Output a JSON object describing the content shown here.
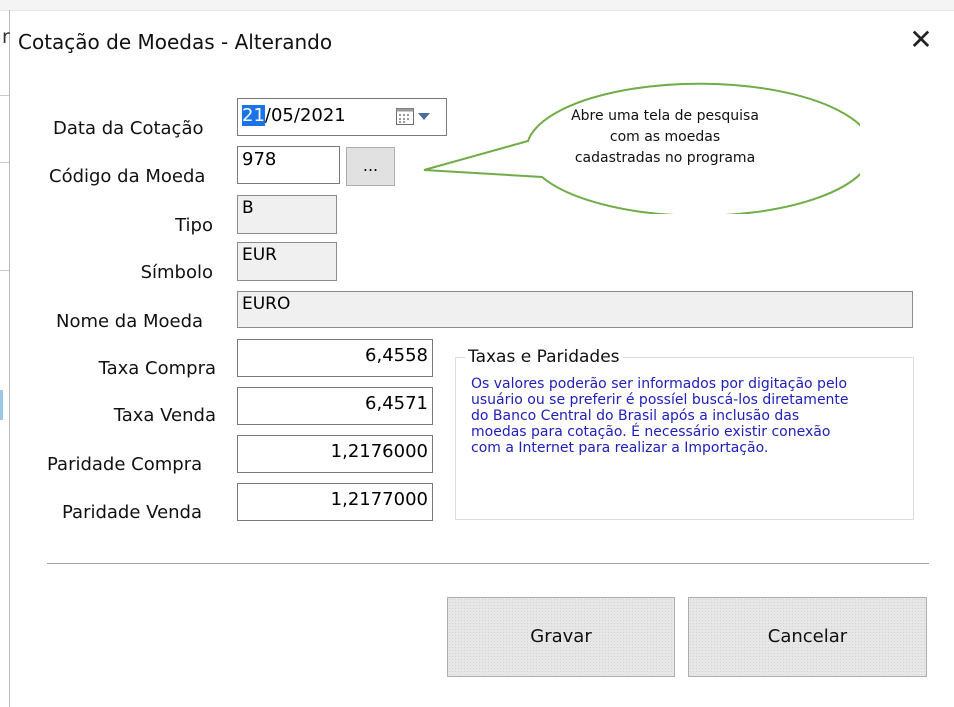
{
  "window": {
    "title": "Cotação de Moedas - Alterando",
    "background_cut_letter": "r",
    "close_label": "✕"
  },
  "form": {
    "date_label": "Data da Cotação",
    "date_day_selected": "21",
    "date_rest": "/05/2021",
    "currency_code_label": "Código da Moeda",
    "currency_code_value": "978",
    "lookup_button_label": "...",
    "type_label": "Tipo",
    "type_value": "B",
    "symbol_label": "Símbolo",
    "symbol_value": "EUR",
    "currency_name_label": "Nome da Moeda",
    "currency_name_value": "EURO",
    "buy_rate_label": "Taxa Compra",
    "buy_rate_value": "6,4558",
    "sell_rate_label": "Taxa Venda",
    "sell_rate_value": "6,4571",
    "buy_parity_label": "Paridade Compra",
    "buy_parity_value": "1,2176000",
    "sell_parity_label": "Paridade Venda",
    "sell_parity_value": "1,2177000"
  },
  "info_group": {
    "title": "Taxas e Paridades",
    "lines": [
      "Os valores poderão ser informados por digitação pelo",
      "usuário ou se preferir é possíel buscá-los diretamente",
      "do Banco Central do Brasil após a inclusão das",
      "moedas para cotação. É necessário existir conexão",
      "com a Internet para realizar a Importação."
    ]
  },
  "buttons": {
    "save": "Gravar",
    "cancel": "Cancelar"
  },
  "callout": {
    "lines": [
      "Abre uma tela de pesquisa",
      "com as moedas",
      "cadastradas no programa"
    ]
  },
  "icons": {
    "calendar": "calendar-icon",
    "dropdown": "chevron-down-icon",
    "close": "close-icon"
  },
  "colors": {
    "selection": "#1a73e8",
    "info_text": "#2020b8",
    "callout_border": "#70ad47"
  }
}
